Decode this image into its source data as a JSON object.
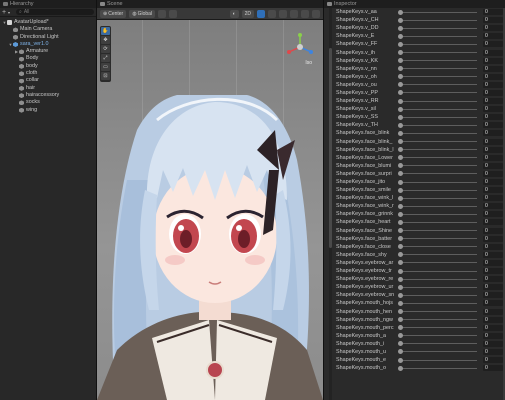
{
  "hierarchy": {
    "title": "Hierarchy",
    "search_value": "All",
    "items": [
      {
        "label": "AvatarUpload*",
        "indent": 0,
        "kind": "scene",
        "arrow": "▼"
      },
      {
        "label": "Main Camera",
        "indent": 1,
        "kind": "object",
        "arrow": ""
      },
      {
        "label": "Directional Light",
        "indent": 1,
        "kind": "object",
        "arrow": ""
      },
      {
        "label": "sara_ver1.0",
        "indent": 1,
        "kind": "avatar",
        "arrow": "▼"
      },
      {
        "label": "Armature",
        "indent": 2,
        "kind": "object",
        "arrow": "▶"
      },
      {
        "label": "Body",
        "indent": 2,
        "kind": "object",
        "arrow": ""
      },
      {
        "label": "body",
        "indent": 2,
        "kind": "object",
        "arrow": ""
      },
      {
        "label": "cloth",
        "indent": 2,
        "kind": "object",
        "arrow": ""
      },
      {
        "label": "collar",
        "indent": 2,
        "kind": "object",
        "arrow": ""
      },
      {
        "label": "hair",
        "indent": 2,
        "kind": "object",
        "arrow": ""
      },
      {
        "label": "hairaccessory",
        "indent": 2,
        "kind": "object",
        "arrow": ""
      },
      {
        "label": "socks",
        "indent": 2,
        "kind": "object",
        "arrow": ""
      },
      {
        "label": "wing",
        "indent": 2,
        "kind": "object",
        "arrow": ""
      }
    ]
  },
  "scene": {
    "title": "Scene",
    "pivot_label": "Center",
    "space_label": "Global",
    "mode_2d": "2D",
    "persp_label": "Iso",
    "tools": [
      "✋",
      "✥",
      "⟳",
      "⤢",
      "▭",
      "⊡"
    ]
  },
  "inspector": {
    "title": "Inspector",
    "shape_keys": [
      {
        "name": "ShapeKeys.v_aa",
        "value": "0"
      },
      {
        "name": "ShapeKeys.v_CH",
        "value": "0"
      },
      {
        "name": "ShapeKeys.v_DD",
        "value": "0"
      },
      {
        "name": "ShapeKeys.v_E",
        "value": "0"
      },
      {
        "name": "ShapeKeys.v_FF",
        "value": "0"
      },
      {
        "name": "ShapeKeys.v_ih",
        "value": "0"
      },
      {
        "name": "ShapeKeys.v_KK",
        "value": "0"
      },
      {
        "name": "ShapeKeys.v_nn",
        "value": "0"
      },
      {
        "name": "ShapeKeys.v_oh",
        "value": "0"
      },
      {
        "name": "ShapeKeys.v_ou",
        "value": "0"
      },
      {
        "name": "ShapeKeys.v_PP",
        "value": "0"
      },
      {
        "name": "ShapeKeys.v_RR",
        "value": "0"
      },
      {
        "name": "ShapeKeys.v_sil",
        "value": "0"
      },
      {
        "name": "ShapeKeys.v_SS",
        "value": "0"
      },
      {
        "name": "ShapeKeys.v_TH",
        "value": "0"
      },
      {
        "name": "ShapeKeys.face_blink",
        "value": "0"
      },
      {
        "name": "ShapeKeys.face_blink_",
        "value": "0"
      },
      {
        "name": "ShapeKeys.face_blink_l",
        "value": "0"
      },
      {
        "name": "ShapeKeys.face_Lower",
        "value": "0"
      },
      {
        "name": "ShapeKeys.face_blumi",
        "value": "0"
      },
      {
        "name": "ShapeKeys.face_surpri",
        "value": "0"
      },
      {
        "name": "ShapeKeys.face_jito",
        "value": "0"
      },
      {
        "name": "ShapeKeys.face_smile",
        "value": "0"
      },
      {
        "name": "ShapeKeys.face_wink_l",
        "value": "0"
      },
      {
        "name": "ShapeKeys.face_wink_r",
        "value": "0"
      },
      {
        "name": "ShapeKeys.face_grinnk",
        "value": "0"
      },
      {
        "name": "ShapeKeys.face_heart",
        "value": "0"
      },
      {
        "name": "ShapeKeys.face_Shine",
        "value": "0"
      },
      {
        "name": "ShapeKeys.face_batter",
        "value": "0"
      },
      {
        "name": "ShapeKeys.face_close",
        "value": "0"
      },
      {
        "name": "ShapeKeys.face_shy",
        "value": "0"
      },
      {
        "name": "ShapeKeys.eyebrow_ar",
        "value": "0"
      },
      {
        "name": "ShapeKeys.eyebrow_tr",
        "value": "0"
      },
      {
        "name": "ShapeKeys.eyebrow_re",
        "value": "0"
      },
      {
        "name": "ShapeKeys.eyebrow_ur",
        "value": "0"
      },
      {
        "name": "ShapeKeys.eyebrow_sn",
        "value": "0"
      },
      {
        "name": "ShapeKeys.mouth_hojs",
        "value": "0"
      },
      {
        "name": "ShapeKeys.mouth_hen",
        "value": "0"
      },
      {
        "name": "ShapeKeys.mouth_ngw",
        "value": "0"
      },
      {
        "name": "ShapeKeys.mouth_perc",
        "value": "0"
      },
      {
        "name": "ShapeKeys.mouth_a",
        "value": "0"
      },
      {
        "name": "ShapeKeys.mouth_i",
        "value": "0"
      },
      {
        "name": "ShapeKeys.mouth_u",
        "value": "0"
      },
      {
        "name": "ShapeKeys.mouth_e",
        "value": "0"
      },
      {
        "name": "ShapeKeys.mouth_o",
        "value": "0"
      }
    ]
  }
}
